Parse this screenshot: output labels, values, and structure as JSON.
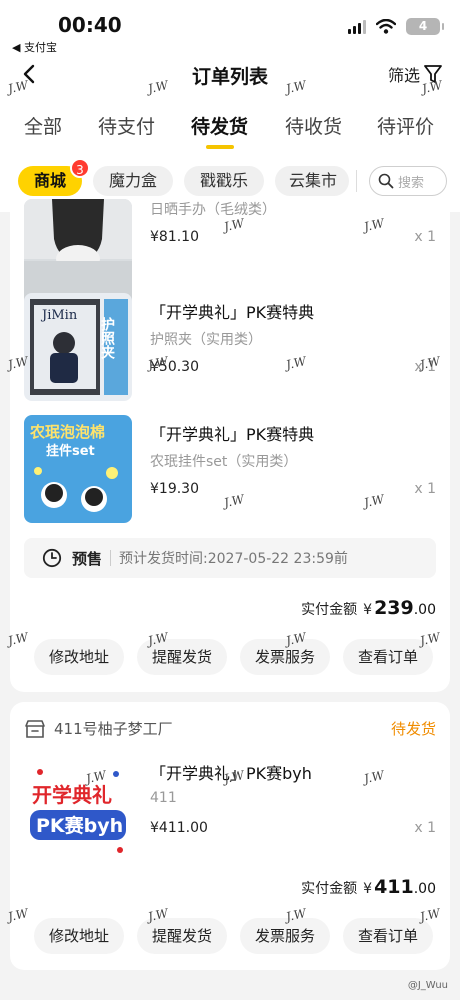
{
  "status_bar": {
    "time": "00:40",
    "back_app": "◀ 支付宝",
    "battery": "4"
  },
  "nav": {
    "title": "订单列表",
    "filter_label": "筛选"
  },
  "tabs": [
    {
      "label": "全部"
    },
    {
      "label": "待支付"
    },
    {
      "label": "待发货",
      "active": true
    },
    {
      "label": "待收货"
    },
    {
      "label": "待评价"
    }
  ],
  "chips": [
    {
      "label": "商城",
      "active": true,
      "badge": "3"
    },
    {
      "label": "魔力盒"
    },
    {
      "label": "戳戳乐"
    },
    {
      "label": "云集市"
    }
  ],
  "search": {
    "placeholder": "搜索"
  },
  "order1": {
    "items": [
      {
        "name": "",
        "spec": "日晒手办（毛绒类）",
        "price": "¥81.10",
        "qty": "x 1"
      },
      {
        "name": "「开学典礼」PK赛特典",
        "spec": "护照夹（实用类）",
        "price": "¥50.30",
        "qty": "x 1"
      },
      {
        "name": "「开学典礼」PK赛特典",
        "spec": "农珉挂件set（实用类）",
        "price": "¥19.30",
        "qty": "x 1"
      }
    ],
    "presale_label": "预售",
    "presale_time": "预计发货时间:2027-05-22 23:59前",
    "total_label": "实付金额",
    "total_currency": "¥",
    "total_int": "239",
    "total_dec": ".00",
    "actions": [
      "修改地址",
      "提醒发货",
      "发票服务",
      "查看订单"
    ]
  },
  "order2": {
    "shop": "411号柚子梦工厂",
    "status": "待发货",
    "items": [
      {
        "name": "「开学典礼」PK赛byh",
        "spec": "411",
        "price": "¥411.00",
        "qty": "x 1"
      }
    ],
    "total_label": "实付金额",
    "total_currency": "¥",
    "total_int": "411",
    "total_dec": ".00",
    "actions": [
      "修改地址",
      "提醒发货",
      "发票服务",
      "查看订单"
    ]
  },
  "thumb_text": {
    "jimin": "JiMin",
    "passport": "护照夹",
    "charm_title": "农珉泡泡棉",
    "charm_sub": "挂件set",
    "pk_line1": "开学典礼",
    "pk_line2": "PK赛byh"
  },
  "watermark": {
    "text": "J.W",
    "credit": "@J_Wuu"
  },
  "colors": {
    "accent": "#ffd200",
    "badge": "#ff3b30",
    "status_orange": "#f08c00"
  }
}
